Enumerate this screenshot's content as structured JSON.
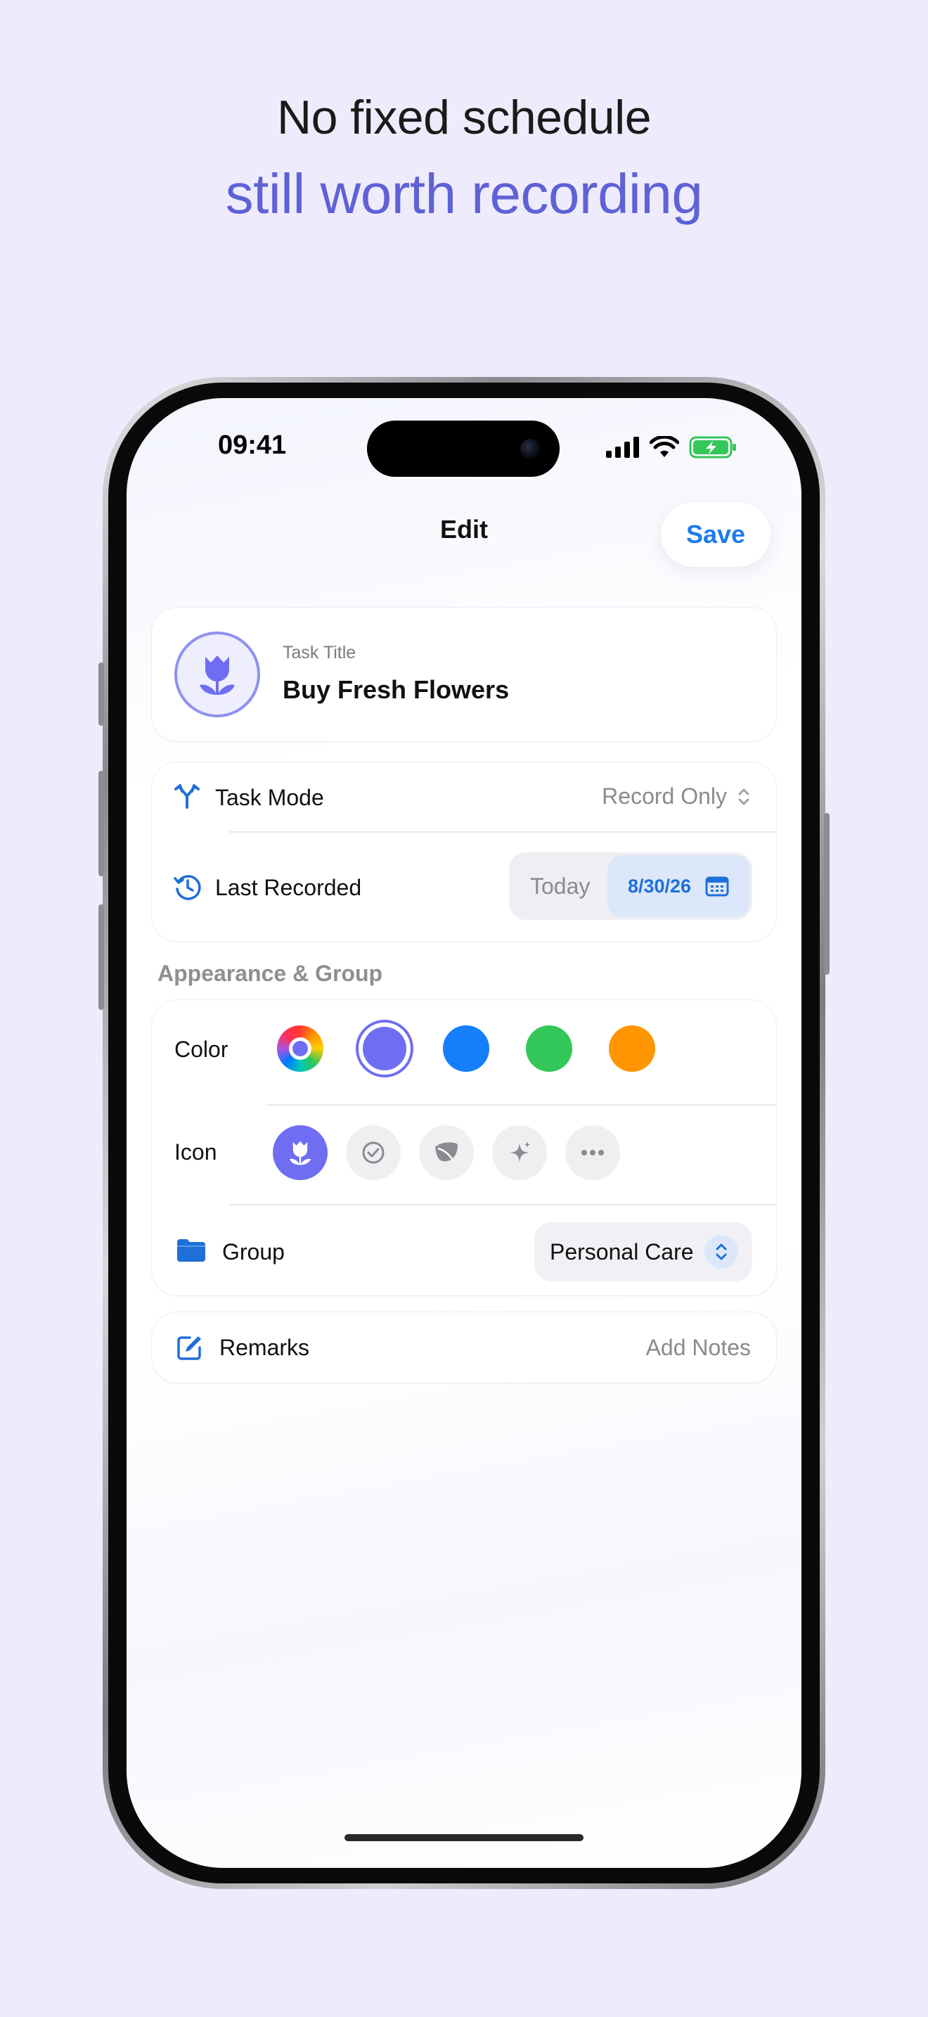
{
  "headline": "No fixed schedule",
  "subheadline": "still worth recording",
  "status_bar": {
    "time": "09:41"
  },
  "nav": {
    "title": "Edit",
    "save_label": "Save"
  },
  "task": {
    "label": "Task Title",
    "value": "Buy Fresh Flowers",
    "icon": "tulip-icon"
  },
  "mode_section": {
    "task_mode_label": "Task Mode",
    "task_mode_value": "Record Only",
    "last_recorded_label": "Last Recorded",
    "today_label": "Today",
    "date_value": "8/30/26"
  },
  "appearance": {
    "header": "Appearance & Group",
    "color_label": "Color",
    "colors": [
      "multicolor",
      "#6F6EF2",
      "#147EFB",
      "#34C759",
      "#FF9500"
    ],
    "selected_color": "#6F6EF2",
    "icon_label": "Icon",
    "icons": [
      "tulip-icon",
      "checkmark-circle-icon",
      "leaf-icon",
      "sparkles-icon",
      "more-icon"
    ],
    "selected_icon": "tulip-icon",
    "group_label": "Group",
    "group_value": "Personal Care"
  },
  "remarks": {
    "label": "Remarks",
    "placeholder": "Add Notes"
  },
  "colors": {
    "accent": "#5F61D6",
    "blue": "#1E7BF0",
    "background": "#EEECFC"
  }
}
